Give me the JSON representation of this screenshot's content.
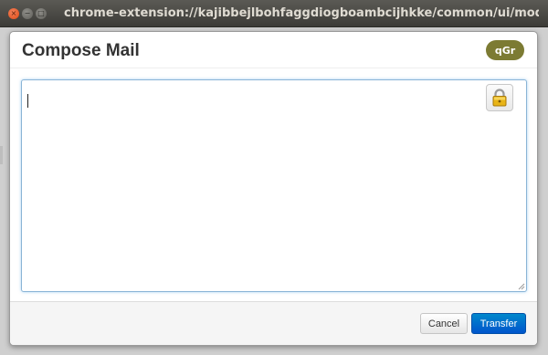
{
  "window": {
    "title": "chrome-extension://kajibbejlbohfaggdiogboambcijhkke/common/ui/modal/editor.html?par",
    "controls": {
      "close_glyph": "×",
      "minimize_glyph": "−",
      "maximize_glyph": "□"
    }
  },
  "modal": {
    "title": "Compose Mail",
    "badge": "qGr",
    "editor": {
      "value": "",
      "lock_icon": "padlock-icon"
    },
    "footer": {
      "cancel_label": "Cancel",
      "transfer_label": "Transfer"
    }
  },
  "colors": {
    "badge": "#7c7b33",
    "primary_button": "#0066cc",
    "editor_border": "#8ab4d6",
    "titlebar": "#3c3b37"
  }
}
